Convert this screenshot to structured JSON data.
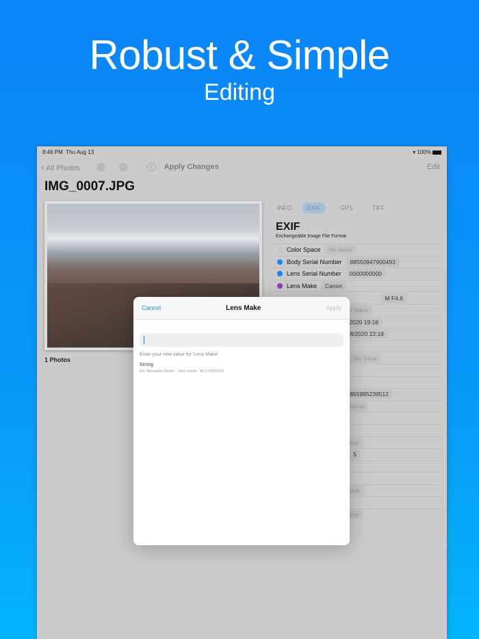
{
  "hero": {
    "title": "Robust & Simple",
    "subtitle": "Editing"
  },
  "status": {
    "time": "8:46 PM",
    "date": "Thu Aug 13",
    "battery": "100%"
  },
  "nav": {
    "back": "All Photos",
    "apply": "Apply Changes",
    "edit": "Edit"
  },
  "file": {
    "name": "IMG_0007.JPG",
    "count": "1 Photos"
  },
  "tabs": [
    {
      "label": "INFO"
    },
    {
      "label": "EXIF"
    },
    {
      "label": "GPS"
    },
    {
      "label": "TIFF"
    }
  ],
  "section": {
    "title": "EXIF",
    "subtitle": "Exchangeable Image File Format"
  },
  "rows": [
    {
      "label": "Color Space",
      "value": "No Value",
      "color": "#c4c4c4"
    },
    {
      "label": "Body Serial Number",
      "value": "88550947900493",
      "color": "#1a84f5"
    },
    {
      "label": "Lens Serial Number",
      "value": "0000000000",
      "color": "#1a84f5"
    },
    {
      "label": "Lens Make",
      "value": "Canon",
      "color": "#8e3fb5"
    },
    {
      "value": "M F4.6"
    },
    {
      "value": "No Value"
    },
    {
      "value": "/2020 19:18"
    },
    {
      "value": "08/2020 22:19"
    },
    {
      "value": ""
    },
    {
      "value": "No Value"
    },
    {
      "value": ""
    },
    {
      "value": ""
    },
    {
      "value": "855995239512"
    },
    {
      "value": "Value"
    },
    {
      "value": ""
    },
    {
      "value": ""
    },
    {
      "value": "alue"
    },
    {
      "value": "5"
    },
    {
      "value": ""
    },
    {
      "value": ""
    },
    {
      "value": "Value"
    },
    {
      "value": ""
    },
    {
      "value": "alue"
    }
  ],
  "modal": {
    "cancel": "Cancel",
    "title": "Lens Make",
    "apply": "Apply",
    "input_value": "",
    "hint": "Enter your new value for 'Lens Make'",
    "type": "String",
    "example": "EG 'Metadata Studio', 'John Smith', 'AC123581119'"
  }
}
